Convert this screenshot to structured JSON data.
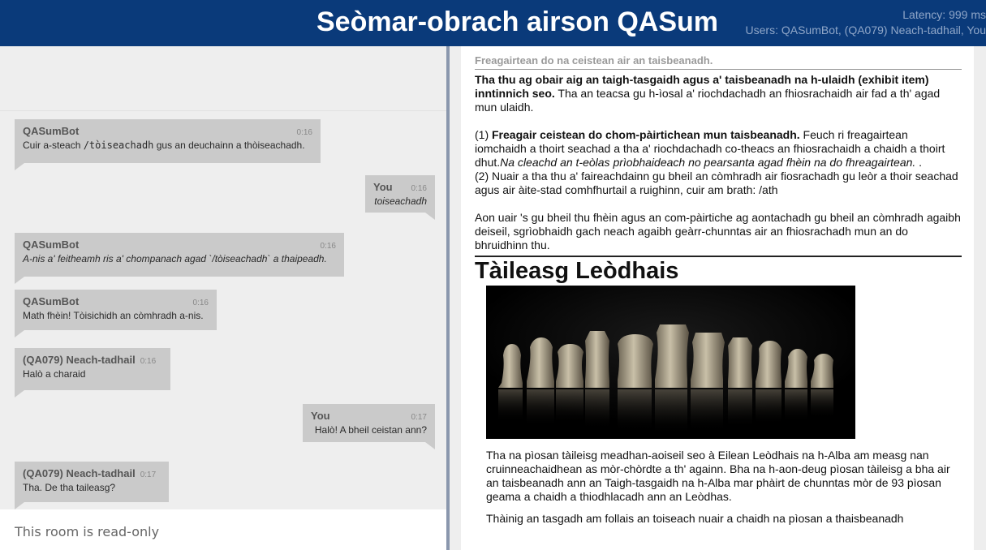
{
  "header": {
    "title": "Seòmar-obrach airson QASum",
    "latency": "Latency: 999 ms",
    "users": "Users: QASumBot, (QA079) Neach-tadhail, You"
  },
  "chat": {
    "messages": [
      {
        "name": "QASumBot",
        "time": "0:16",
        "text_prefix": "Cuir a-steach ",
        "text_code": "/tòiseachadh",
        "text_suffix": " gus an deuchainn a thòiseachadh."
      },
      {
        "name": "You",
        "time": "0:16",
        "text": "toiseachadh"
      },
      {
        "name": "QASumBot",
        "time": "0:16",
        "text": "A-nis a' feitheamh ris a' chompanach agad `/tòiseachadh` a thaipeadh."
      },
      {
        "name": "QASumBot",
        "time": "0:16",
        "text": "Math fhèin! Tòisichidh an còmhradh a-nis."
      },
      {
        "name": "(QA079) Neach-tadhail",
        "time": "0:16",
        "text": "Halò a charaid"
      },
      {
        "name": "You",
        "time": "0:17",
        "text": "Halò! A bheil ceistan ann?"
      },
      {
        "name": "(QA079) Neach-tadhail",
        "time": "0:17",
        "text": "Tha. De tha taileasg?"
      }
    ],
    "readonly_notice": "This room is read-only"
  },
  "document": {
    "caption": "Freagairtean do na ceistean air an taisbeanadh.",
    "intro_bold": "Tha thu ag obair aig an taigh-tasgaidh agus a' taisbeanadh na h-ulaidh (exhibit item) inntinnich seo.",
    "intro_rest": " Tha an teacsa gu h-ìosal a' riochdachadh an fhiosrachaidh air fad a th' agad mun ulaidh.",
    "step1_num": "(1) ",
    "step1_bold": "Freagair ceistean do chom-pàirtichean mun taisbeanadh.",
    "step1_rest": " Feuch ri freagairtean iomchaidh a thoirt seachad a tha a' riochdachadh co-theacs an fhiosrachaidh a chaidh a thoirt dhut.",
    "step1_italic": "Na cleachd an t-eòlas prìobhaideach no pearsanta agad fhèin na do fhreagairtean.",
    "step1_end": " .",
    "step2": "(2) Nuair a tha thu a' faireachdainn gu bheil an còmhradh air fiosrachadh gu leòr a thoir seachad agus air àite-stad comhfhurtail a ruighinn, cuir am brath: /ath",
    "summary": "Aon uair 's gu bheil thu fhèin agus an com-pàirtiche ag aontachadh gu bheil an còmhradh agaibh deiseil, sgrìobhaidh gach neach agaibh geàrr-chunntas air an fhiosrachadh mun an do bhruidhinn thu.",
    "title": "Tàileasg Leòdhais",
    "body1": "Tha na pìosan tàileisg meadhan-aoiseil seo à Eilean Leòdhais na h-Alba am measg nan cruinneachaidhean as mòr-chòrdte a th' againn. Bha na h-aon-deug pìosan tàileisg a bha air an taisbeanadh ann an Taigh-tasgaidh na h-Alba mar phàirt de chunntas mòr de 93 pìosan geama a chaidh a thiodhlacadh ann an Leòdhas.",
    "body2": "Thàinig an tasgadh am follais an toiseach nuair a chaidh na pìosan a thaisbeanadh"
  },
  "colors": {
    "header_bg": "#0a3a7a",
    "bubble_bg": "#cacaca",
    "pane_bg": "#eeeeee"
  }
}
